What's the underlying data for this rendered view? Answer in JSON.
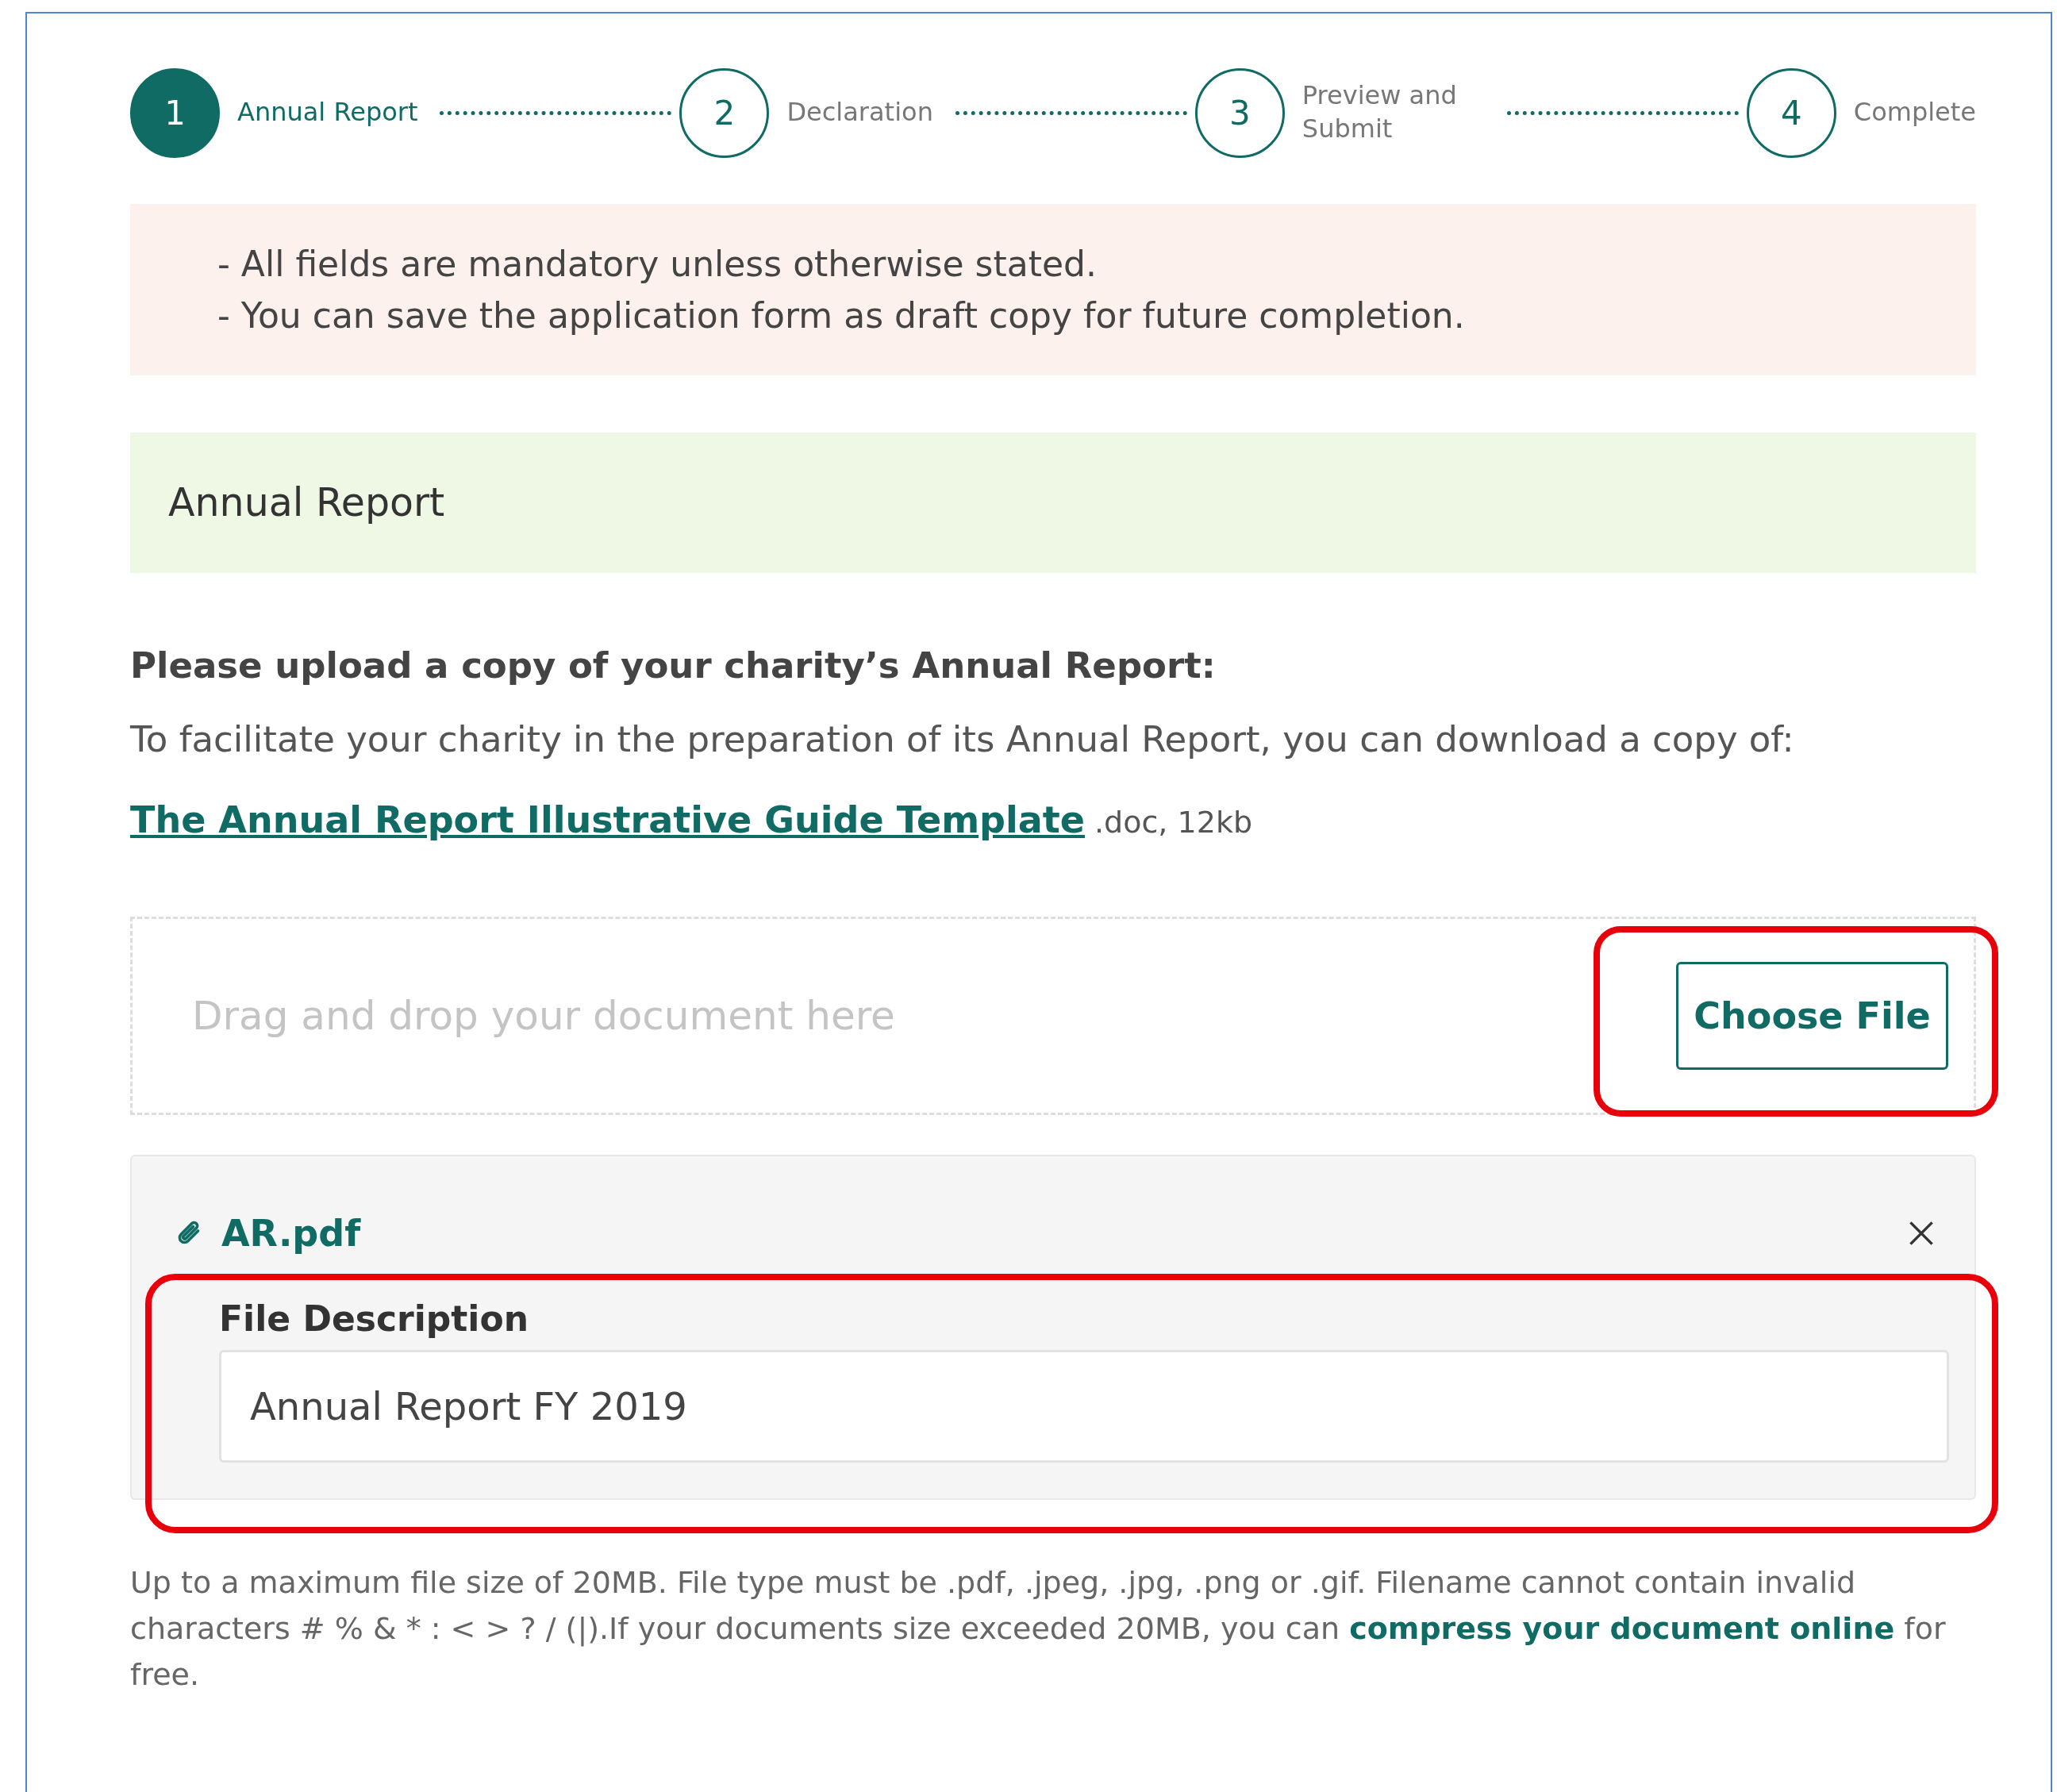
{
  "steps": [
    {
      "number": "1",
      "label": "Annual Report",
      "selected": true
    },
    {
      "number": "2",
      "label": "Declaration",
      "selected": false
    },
    {
      "number": "3",
      "label": "Preview and Submit",
      "selected": false
    },
    {
      "number": "4",
      "label": "Complete",
      "selected": false
    }
  ],
  "notice": {
    "lines": [
      "- All fields are mandatory unless otherwise stated.",
      "- You can save the application form as draft copy for future completion."
    ]
  },
  "section_title": "Annual Report",
  "prompt": "Please upload a copy of your charity’s Annual Report:",
  "intro": "To facilitate your charity in the preparation of its Annual Report, you can download a copy of:",
  "template_link": {
    "text": "The Annual Report Illustrative Guide Template",
    "meta": ".doc, 12kb"
  },
  "dropzone": {
    "placeholder": "Drag and drop your document here",
    "button": "Choose File",
    "highlighted": true
  },
  "file": {
    "name": "AR.pdf",
    "description_label": "File Description",
    "description_value": "Annual Report FY 2019",
    "highlighted": true
  },
  "footnote": {
    "before": "Up to a maximum file size of 20MB. File type must be .pdf, .jpeg, .jpg, .png or .gif. Filename cannot contain invalid characters # % & * : < > ? / (|).If your documents size exceeded 20MB, you can ",
    "link": "compress your document online",
    "after": " for free."
  }
}
